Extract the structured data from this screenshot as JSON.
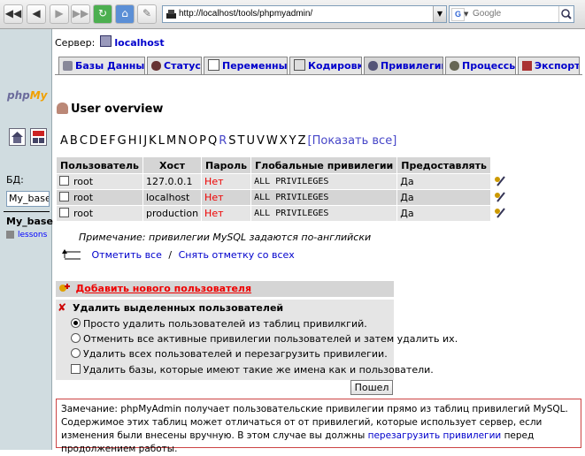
{
  "browser": {
    "url": "http://localhost/tools/phpmyadmin/",
    "search_placeholder": "Google",
    "search_engine_letter": "G"
  },
  "nav": {
    "logo_part1": "php",
    "logo_part2": "My",
    "db_label": "БД:",
    "db_select_value": "My_base",
    "current_db": "My_base",
    "table_item": "lessons"
  },
  "server": {
    "label": "Сервер:",
    "host": "localhost"
  },
  "tabs": [
    {
      "label": "Базы Данных"
    },
    {
      "label": "Статус"
    },
    {
      "label": "Переменные"
    },
    {
      "label": "Кодировки"
    },
    {
      "label": "Привилегии"
    },
    {
      "label": "Процессы"
    },
    {
      "label": "Экспорт"
    }
  ],
  "page_title": "User overview",
  "alphabet": [
    "A",
    "B",
    "C",
    "D",
    "E",
    "F",
    "G",
    "H",
    "I",
    "J",
    "K",
    "L",
    "M",
    "N",
    "O",
    "P",
    "Q",
    "R",
    "S",
    "T",
    "U",
    "V",
    "W",
    "X",
    "Y",
    "Z"
  ],
  "show_all": "[Показать все]",
  "table": {
    "headers": [
      "Пользователь",
      "Хост",
      "Пароль",
      "Глобальные привилегии",
      "Предоставлять"
    ],
    "rows": [
      {
        "user": "root",
        "host": "127.0.0.1",
        "password": "Нет",
        "privileges": "ALL PRIVILEGES",
        "grant": "Да"
      },
      {
        "user": "root",
        "host": "localhost",
        "password": "Нет",
        "privileges": "ALL PRIVILEGES",
        "grant": "Да"
      },
      {
        "user": "root",
        "host": "production",
        "password": "Нет",
        "privileges": "ALL PRIVILEGES",
        "grant": "Да"
      }
    ]
  },
  "note": "Примечание: привилегии MySQL задаются по-английски",
  "check_all": "Отметить все",
  "separator": "/",
  "uncheck_all": "Снять отметку со всех",
  "add_user": "Добавить нового пользователя",
  "delete": {
    "title": "Удалить выделенных пользователей",
    "opt1": "Просто удалить пользователей из таблиц привилкгий.",
    "opt2": "Отменить все активные привилегии пользователей и затем удалить их.",
    "opt3": "Удалить всех пользователей и перезагрузить привилегии.",
    "opt4": "Удалить базы, которые имеют такие же имена как и пользователи."
  },
  "go_button": "Пошел",
  "remark": {
    "text1": "Замечание: phpMyAdmin получает пользовательские привилегии прямо из таблиц привилегий MySQL. Содержимое этих таблиц может отличаться от от привилегий, которые использует сервер, если изменения были внесены вручную. В этом случае вы должны ",
    "link": "перезагрузить привилегии",
    "text2": " перед продолжением работы."
  }
}
